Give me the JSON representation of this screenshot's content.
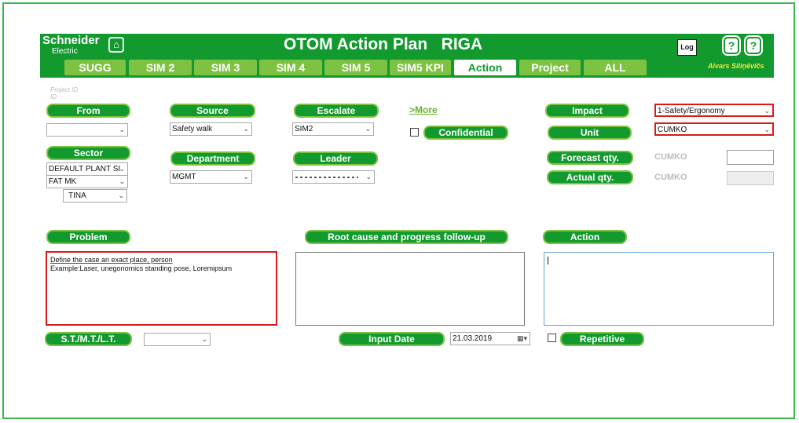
{
  "header": {
    "brand_main": "Schneider",
    "brand_sub": "Electric",
    "title": "OTOM Action Plan   RIGA",
    "log_label": "Log",
    "user_name": "Aivars Siliņēvičs"
  },
  "tabs": [
    "SUGG",
    "SIM 2",
    "SIM 3",
    "SIM 4",
    "SIM 5",
    "SIM5 KPI",
    "Action",
    "Project",
    "ALL"
  ],
  "active_tab": "Action",
  "form": {
    "project_id_placeholder": "Project ID",
    "project_id_sub": "ID",
    "from_label": "From",
    "from_value": "",
    "source_label": "Source",
    "source_value": "Safety walk",
    "escalate_label": "Escalate",
    "escalate_value": "SIM2",
    "more_label": "More",
    "confidential_label": "Confidential",
    "impact_label": "Impact",
    "impact_value": "1-Safety/Ergonomy",
    "unit_label": "Unit",
    "unit_value": "CUMKO",
    "sector_label": "Sector",
    "sector_values": [
      "DEFAULT PLANT SI",
      "FAT MK",
      "TINA"
    ],
    "department_label": "Department",
    "department_value": "MGMT",
    "leader_label": "Leader",
    "leader_value": "",
    "forecast_label": "Forecast qty.",
    "forecast_unit": "CUMKO",
    "actual_label": "Actual qty.",
    "actual_unit": "CUMKO",
    "problem_label": "Problem",
    "problem_text_line1": "Define the case an exact place, person",
    "problem_text_line2": "Example:Laser, unegonomics standing pose, Loremipsum",
    "root_label": "Root cause and progress follow-up",
    "action_label": "Action",
    "stmt_label": "S.T./M.T./L.T.",
    "input_date_label": "Input Date",
    "input_date_value": "21.03.2019",
    "repetitive_label": "Repetitive"
  },
  "colors": {
    "brand_green": "#139a2f",
    "tab_green": "#7dc242",
    "highlight_red": "#d8191c",
    "frame_green": "#3cb84a",
    "user_yellow": "#f5ea3a"
  }
}
